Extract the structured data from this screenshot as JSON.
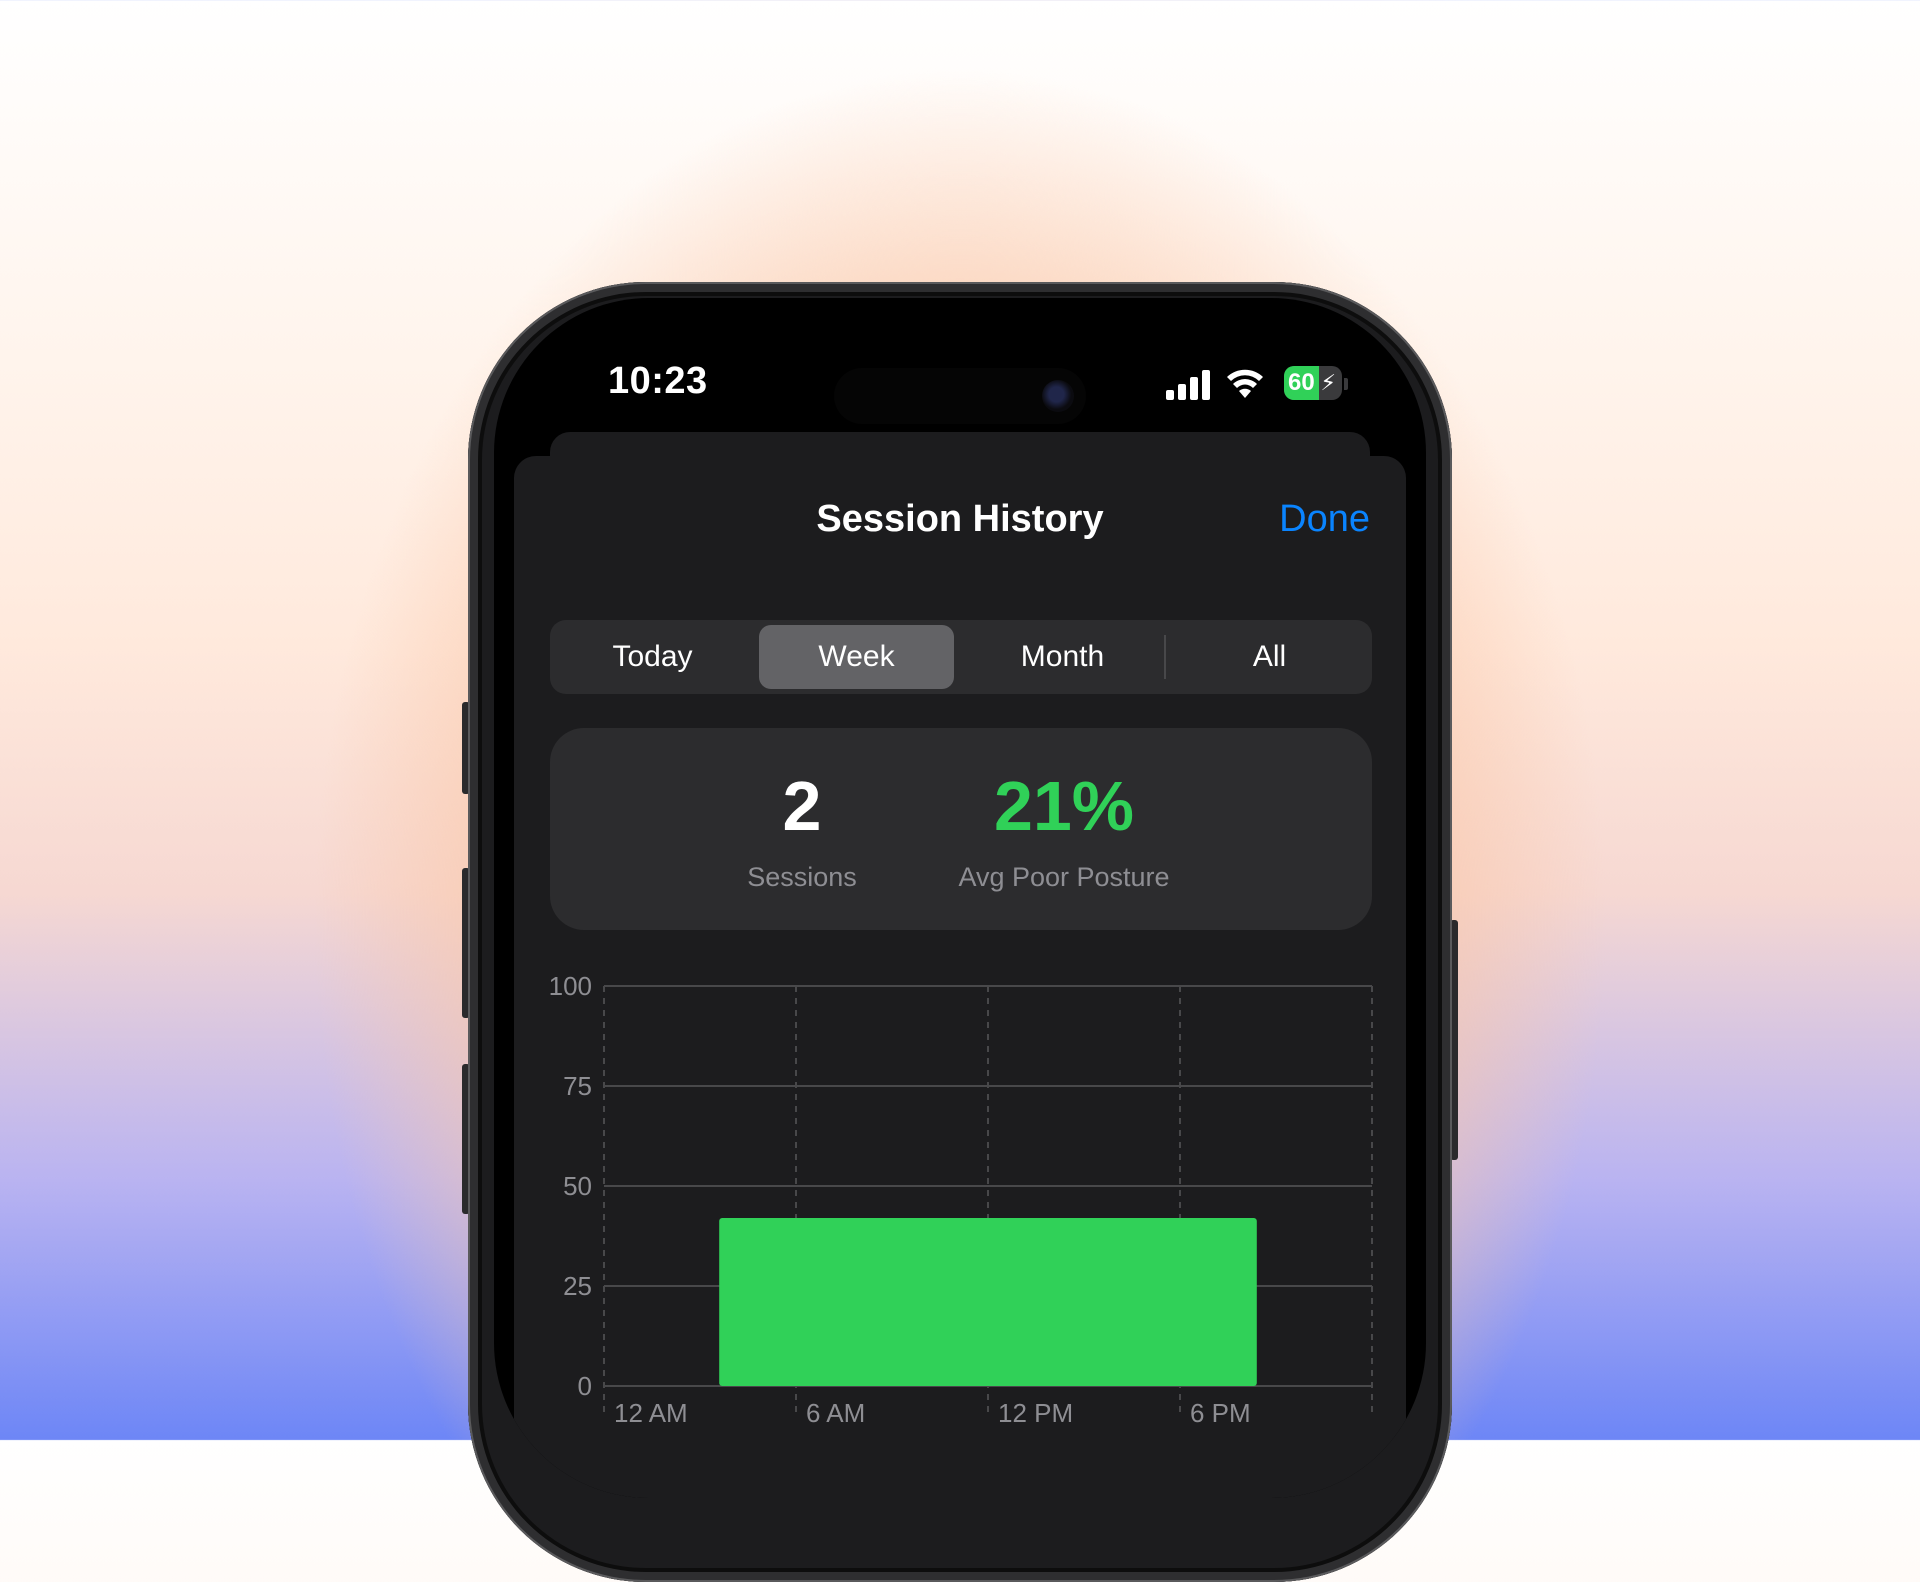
{
  "status_bar": {
    "time": "10:23",
    "battery_level": "60",
    "battery_percent": 60,
    "icons": [
      "signal-icon",
      "wifi-icon",
      "battery-charging-icon"
    ]
  },
  "sheet": {
    "title": "Session History",
    "done_label": "Done"
  },
  "segments": {
    "items": [
      "Today",
      "Week",
      "Month",
      "All"
    ],
    "selected": "Week"
  },
  "stats": {
    "sessions_value": "2",
    "sessions_label": "Sessions",
    "poor_posture_value": "21%",
    "poor_posture_label": "Avg Poor Posture"
  },
  "colors": {
    "accent": "#0a84ff",
    "good": "#30d158",
    "background": "#1c1c1e",
    "card": "#2c2c2e"
  },
  "chart_data": {
    "type": "bar",
    "x_ticks": [
      "12 AM",
      "6 AM",
      "12 PM",
      "6 PM"
    ],
    "y_ticks": [
      0,
      25,
      50,
      75,
      100
    ],
    "ylim": [
      0,
      100
    ],
    "xlim_hours": [
      0,
      24
    ],
    "bars": [
      {
        "start_hour": 3.6,
        "end_hour": 20.4,
        "value": 42
      }
    ],
    "grid": true
  }
}
